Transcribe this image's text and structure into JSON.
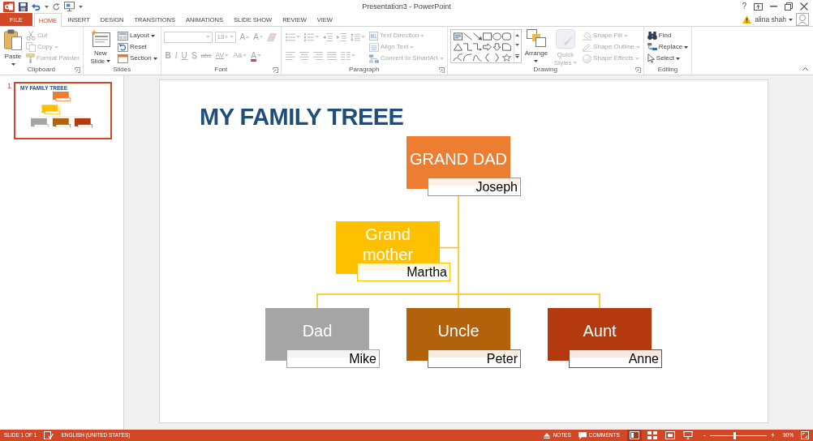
{
  "title_bar": {
    "title": "Presentation3 - PowerPoint",
    "help": "?"
  },
  "tabs": [
    {
      "label": "FILE",
      "kind": "file",
      "selected": false
    },
    {
      "label": "HOME",
      "kind": "tab",
      "selected": true
    },
    {
      "label": "INSERT",
      "kind": "tab",
      "selected": false
    },
    {
      "label": "DESIGN",
      "kind": "tab",
      "selected": false
    },
    {
      "label": "TRANSITIONS",
      "kind": "tab",
      "selected": false
    },
    {
      "label": "ANIMATIONS",
      "kind": "tab",
      "selected": false
    },
    {
      "label": "SLIDE SHOW",
      "kind": "tab",
      "selected": false
    },
    {
      "label": "REVIEW",
      "kind": "tab",
      "selected": false
    },
    {
      "label": "VIEW",
      "kind": "tab",
      "selected": false
    }
  ],
  "account": {
    "user": "alina shah"
  },
  "ribbon": [
    {
      "kind": "clipboard",
      "label": "Clipboard",
      "launcher": true,
      "buttons": [
        {
          "kind": "paste",
          "label": "Paste",
          "dropdown": true,
          "disabled": false
        },
        {
          "kind": "cut",
          "label": "Cut",
          "dropdown": false,
          "disabled": true
        },
        {
          "kind": "copy",
          "label": "Copy",
          "dropdown": true,
          "disabled": true
        },
        {
          "kind": "format-painter",
          "label": "Format Painter",
          "dropdown": false,
          "disabled": true
        }
      ]
    },
    {
      "kind": "slides",
      "label": "Slides",
      "launcher": false,
      "buttons": [
        {
          "kind": "new-slide",
          "label": "New Slide",
          "dropdown": true,
          "disabled": false
        },
        {
          "kind": "layout",
          "label": "Layout",
          "dropdown": true,
          "disabled": false
        },
        {
          "kind": "reset",
          "label": "Reset",
          "dropdown": false,
          "disabled": false
        },
        {
          "kind": "section",
          "label": "Section",
          "dropdown": true,
          "disabled": false
        }
      ]
    },
    {
      "kind": "font",
      "label": "Font",
      "launcher": true,
      "buttons": [
        {
          "kind": "font-name",
          "dropdown": true,
          "disabled": true
        },
        {
          "kind": "font-size",
          "value": "18+",
          "dropdown": true,
          "disabled": true
        },
        {
          "kind": "grow",
          "label": "A",
          "dropdown": false,
          "disabled": true
        },
        {
          "kind": "shrink",
          "label": "A",
          "dropdown": false,
          "disabled": true
        },
        {
          "kind": "clear",
          "dropdown": false,
          "disabled": true
        },
        {
          "kind": "bold",
          "label": "B",
          "dropdown": false,
          "disabled": true
        },
        {
          "kind": "italic",
          "label": "I",
          "dropdown": false,
          "disabled": true
        },
        {
          "kind": "underline",
          "label": "U",
          "dropdown": false,
          "disabled": true
        },
        {
          "kind": "shadow",
          "label": "S",
          "dropdown": false,
          "disabled": true
        },
        {
          "kind": "strike",
          "label": "abc",
          "dropdown": false,
          "disabled": true
        },
        {
          "kind": "spacing",
          "label": "AV",
          "dropdown": true,
          "disabled": true
        },
        {
          "kind": "case",
          "label": "Aa",
          "dropdown": true,
          "disabled": true
        },
        {
          "kind": "color",
          "label": "A",
          "dropdown": true,
          "disabled": true
        }
      ]
    },
    {
      "kind": "paragraph",
      "label": "Paragraph",
      "launcher": true,
      "buttons": [
        {
          "kind": "bullets",
          "dropdown": true,
          "disabled": true
        },
        {
          "kind": "numbering",
          "dropdown": true,
          "disabled": true
        },
        {
          "kind": "outdent",
          "dropdown": false,
          "disabled": true
        },
        {
          "kind": "indent",
          "dropdown": false,
          "disabled": true
        },
        {
          "kind": "line-spacing",
          "dropdown": true,
          "disabled": true
        },
        {
          "kind": "text-direction",
          "label": "Text Direction",
          "dropdown": true,
          "disabled": true
        },
        {
          "kind": "align-left",
          "dropdown": false,
          "disabled": true
        },
        {
          "kind": "center",
          "dropdown": false,
          "disabled": true
        },
        {
          "kind": "align-right",
          "dropdown": false,
          "disabled": true
        },
        {
          "kind": "justify",
          "dropdown": false,
          "disabled": true
        },
        {
          "kind": "columns",
          "dropdown": true,
          "disabled": true
        },
        {
          "kind": "align-text",
          "label": "Align Text",
          "dropdown": true,
          "disabled": true
        },
        {
          "kind": "smartart",
          "label": "Convert to SmartArt",
          "dropdown": true,
          "disabled": true
        }
      ]
    },
    {
      "kind": "drawing",
      "label": "Drawing",
      "launcher": true,
      "buttons": [
        {
          "kind": "shapes-gallery"
        },
        {
          "kind": "arrange",
          "label": "Arrange",
          "dropdown": true,
          "disabled": false
        },
        {
          "kind": "quick-styles",
          "label": "Quick Styles",
          "dropdown": true,
          "disabled": true
        },
        {
          "kind": "shape-fill",
          "label": "Shape Fill",
          "dropdown": true,
          "disabled": true
        },
        {
          "kind": "shape-outline",
          "label": "Shape Outline",
          "dropdown": true,
          "disabled": true
        },
        {
          "kind": "shape-effects",
          "label": "Shape Effects",
          "dropdown": true,
          "disabled": true
        }
      ]
    },
    {
      "kind": "editing",
      "label": "Editing",
      "launcher": false,
      "buttons": [
        {
          "kind": "find",
          "label": "Find",
          "dropdown": false,
          "disabled": false
        },
        {
          "kind": "replace",
          "label": "Replace",
          "dropdown": true,
          "disabled": false
        },
        {
          "kind": "select",
          "label": "Select",
          "dropdown": true,
          "disabled": false
        }
      ]
    }
  ],
  "slides_pane": [
    {
      "number": "1",
      "title": "MY FAMILY TREEE",
      "selected": true
    }
  ],
  "slide": {
    "title": "MY FAMILY TREEE",
    "org_chart": {
      "title": "GRAND DAD",
      "name": "Joseph",
      "color": "#ed7d31",
      "assistants": [
        {
          "title": "Grand mother",
          "name": "Martha",
          "color": "#ffc000"
        }
      ],
      "children": [
        {
          "title": "Dad",
          "name": "Mike",
          "color": "#a5a5a5"
        },
        {
          "title": "Uncle",
          "name": "Peter",
          "color": "#b1620b"
        },
        {
          "title": "Aunt",
          "name": "Anne",
          "color": "#b5390e"
        }
      ]
    }
  },
  "status_bar": {
    "slide_info": "SLIDE 1 OF 1",
    "language": "ENGLISH (UNITED STATES)",
    "notes": "NOTES",
    "comments": "COMMENTS",
    "views": [
      {
        "kind": "normal",
        "selected": true
      },
      {
        "kind": "sorter",
        "selected": false
      },
      {
        "kind": "reading",
        "selected": false
      },
      {
        "kind": "slideshow",
        "selected": false
      }
    ],
    "zoom": {
      "out_label": "-",
      "in_label": "+",
      "level": 0.44,
      "reading": "90%"
    }
  }
}
